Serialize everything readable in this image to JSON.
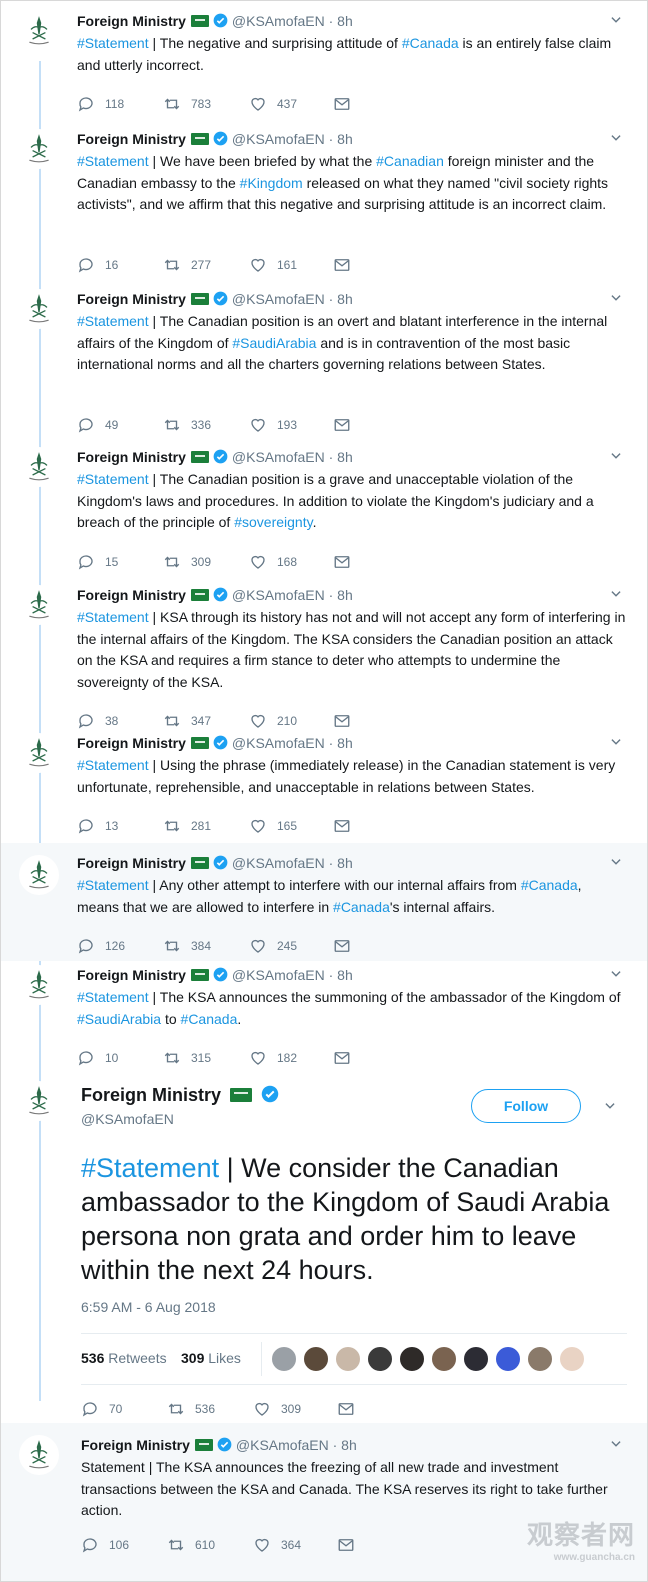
{
  "account": {
    "name": "Foreign Ministry",
    "handle": "@KSAmofaEN",
    "age": "· 8h"
  },
  "tweets": [
    {
      "hashtag": "#Statement",
      "text": " | The negative and surprising attitude of #Canada is an entirely false claim and utterly incorrect.",
      "replies": "118",
      "retweets": "783",
      "likes": "437"
    },
    {
      "hashtag": "#Statement",
      "text": " | We have been briefed by what the #Canadian foreign minister and the Canadian embassy to the #Kingdom released on what they named \"civil society rights activists\", and we affirm that this negative and surprising attitude is an incorrect claim.",
      "replies": "16",
      "retweets": "277",
      "likes": "161"
    },
    {
      "hashtag": "#Statement",
      "text": " | The Canadian position is an overt and blatant interference in the internal affairs of the Kingdom of #SaudiArabia and is in contravention of the most basic international norms and all the charters governing relations between States.",
      "replies": "49",
      "retweets": "336",
      "likes": "193"
    },
    {
      "hashtag": "#Statement",
      "text": " | The Canadian position is a grave and unacceptable violation of the Kingdom's laws and procedures. In addition to violate the Kingdom's judiciary and a breach of the principle of #sovereignty.",
      "replies": "15",
      "retweets": "309",
      "likes": "168"
    },
    {
      "hashtag": "#Statement",
      "text": " | KSA through its history has not and will not accept any form of interfering in the internal affairs of the Kingdom. The KSA considers the Canadian position an attack on the KSA and requires a firm stance to deter who attempts to undermine the sovereignty of the KSA.",
      "replies": "38",
      "retweets": "347",
      "likes": "210"
    },
    {
      "hashtag": "#Statement",
      "text": " | Using the phrase (immediately release) in the Canadian statement is very unfortunate, reprehensible, and unacceptable in relations between States.",
      "replies": "13",
      "retweets": "281",
      "likes": "165"
    },
    {
      "hashtag": "#Statement",
      "text": " | Any other attempt to interfere with our internal affairs from #Canada, means that we are allowed to interfere in #Canada's internal affairs.",
      "replies": "126",
      "retweets": "384",
      "likes": "245"
    },
    {
      "hashtag": "#Statement",
      "text": " | The KSA announces the summoning of the ambassador of the Kingdom of #SaudiArabia to #Canada.",
      "replies": "10",
      "retweets": "315",
      "likes": "182"
    }
  ],
  "featured": {
    "hashtag": "#Statement",
    "text": " | We consider the Canadian ambassador to the Kingdom of Saudi Arabia persona non grata and order him to leave within the next 24 hours.",
    "follow_label": "Follow",
    "timestamp": "6:59 AM - 6 Aug 2018",
    "retweets_count": "536",
    "retweets_label": "Retweets",
    "likes_count": "309",
    "likes_label": "Likes",
    "replies": "70",
    "retweets": "536",
    "likes": "309"
  },
  "last_tweet": {
    "text": "Statement | The KSA announces the freezing of all new trade and investment transactions between the KSA and Canada. The KSA reserves its right to take further action.",
    "replies": "106",
    "retweets": "610",
    "likes": "364"
  },
  "watermark": {
    "line1": "观察者网",
    "line2": "www.guancha.cn"
  },
  "colors": {
    "link": "#1b95e0",
    "muted": "#657786",
    "thread": "#c4dff7",
    "follow": "#1da1f2",
    "flag": "#1b7f3a"
  },
  "likers": [
    "#9aa0a6",
    "#5b4a3a",
    "#c9b8a8",
    "#3a3a3a",
    "#2e2a28",
    "#7a6350",
    "#2c2c34",
    "#3b5bd8",
    "#8a7a6a",
    "#e9d3c4"
  ]
}
